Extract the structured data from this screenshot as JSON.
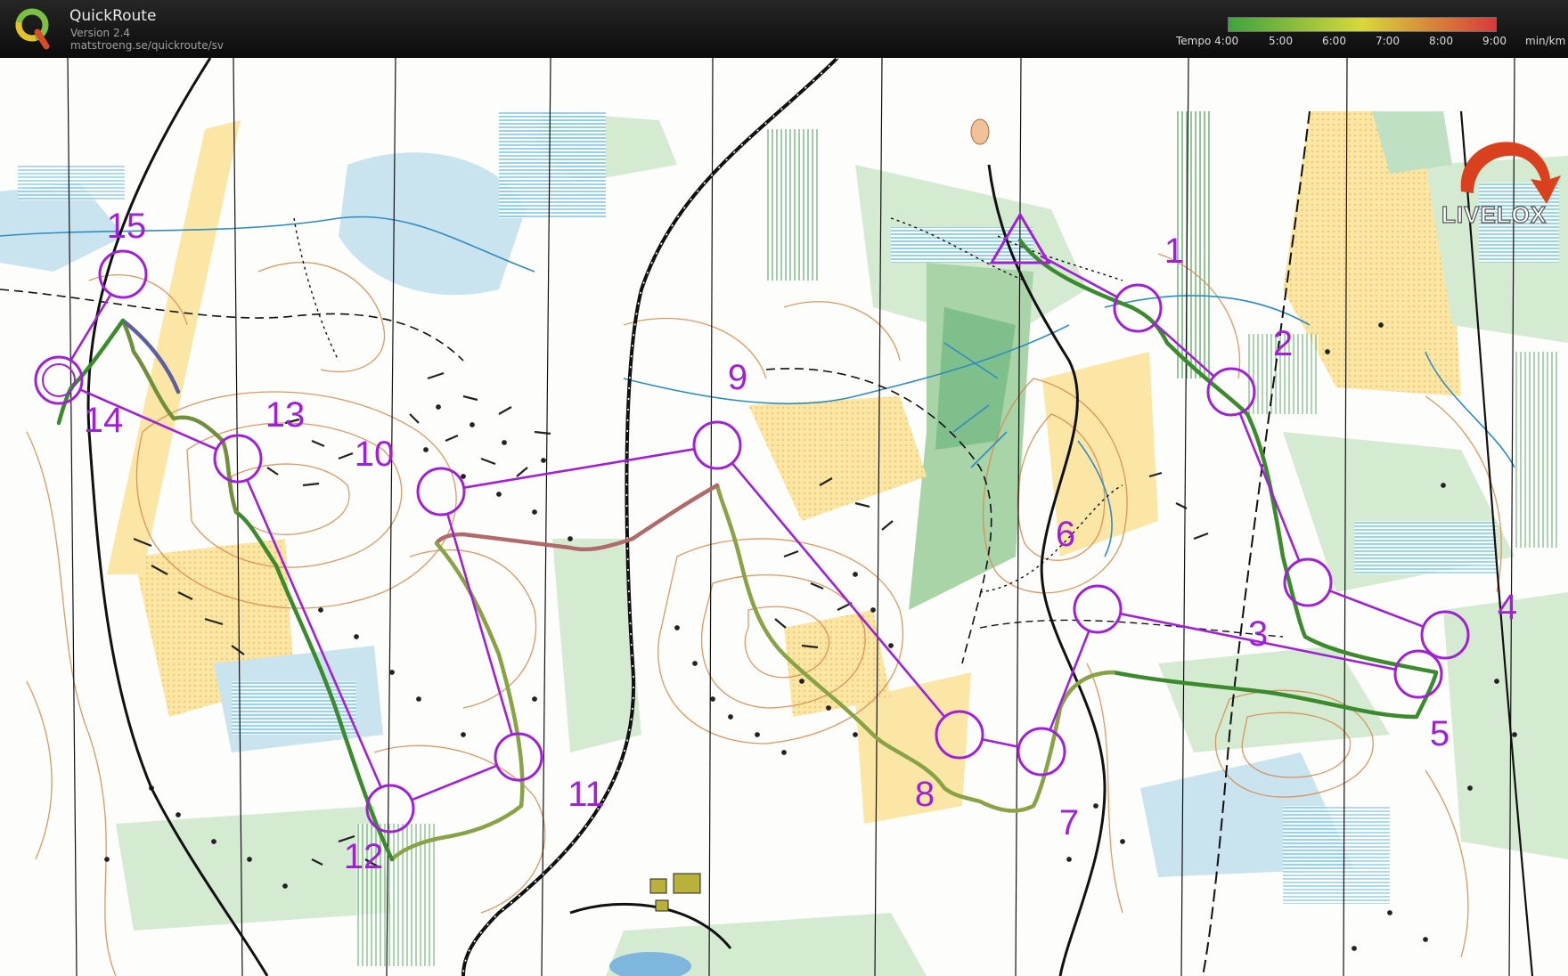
{
  "app": {
    "title": "QuickRoute",
    "version": "Version 2.4",
    "url": "matstroeng.se/quickroute/sv"
  },
  "pace_legend": {
    "label": "Tempo 4:00",
    "ticks": [
      "5:00",
      "6:00",
      "7:00",
      "8:00",
      "9:00"
    ],
    "unit": "min/km",
    "colors": {
      "fast": "#3fa33f",
      "mid": "#d8d83a",
      "slow": "#d83a3a"
    }
  },
  "watermark": {
    "text": "LIVELOX"
  },
  "course": {
    "color": "#a020d8",
    "start": {
      "label": ""
    },
    "controls": [
      {
        "number": "1"
      },
      {
        "number": "2"
      },
      {
        "number": "3"
      },
      {
        "number": "4"
      },
      {
        "number": "5"
      },
      {
        "number": "6"
      },
      {
        "number": "7"
      },
      {
        "number": "8"
      },
      {
        "number": "9"
      },
      {
        "number": "10"
      },
      {
        "number": "11"
      },
      {
        "number": "12"
      },
      {
        "number": "13"
      },
      {
        "number": "14"
      },
      {
        "number": "15"
      }
    ]
  },
  "route": {
    "colors": {
      "fast": "#3b8a2e",
      "normal": "#8aa246",
      "slow": "#b06a6a"
    }
  }
}
